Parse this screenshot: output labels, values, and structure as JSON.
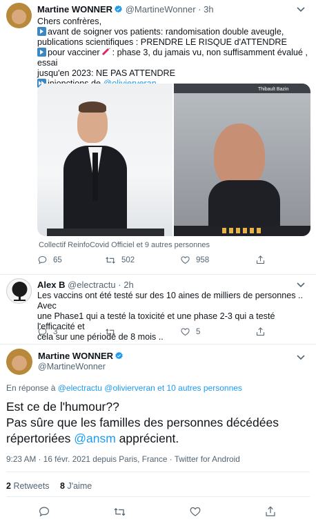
{
  "tweet1": {
    "author_name": "Martine WONNER",
    "author_handle": "@MartineWonner",
    "dot": "·",
    "time": "3h",
    "lines": [
      "Chers confrères,",
      "avant de soigner vos patients: randomisation double aveugle,",
      "publications scientifiques : PRENDRE LE RISQUE d'ATTENDRE",
      "pour vacciner",
      ": phase 3,  du jamais vu, non suffisamment évalué , essai",
      "jusqu'en 2023: NE PAS ATTENDRE",
      "injonctions de",
      "@olivierveran"
    ],
    "video_overlay_name": "Thibault Bazin",
    "liked_by": "Collectif ReinfoCovid Officiel et 9 autres personnes",
    "replies": "65",
    "retweets": "502",
    "likes": "958"
  },
  "reply": {
    "author_name": "Alex B",
    "author_handle": "@electractu",
    "dot": "·",
    "time": "2h",
    "lines": [
      "Les vaccins ont été testé sur des 10 aines de milliers de personnes .. Avec",
      "une Phase1 qui a testé la toxicité et une phase 2-3 qui a testé l'efficacité et",
      "cela sur une période de 8 mois .."
    ],
    "replies": "3",
    "retweets": "",
    "likes": "5"
  },
  "main": {
    "author_name": "Martine WONNER",
    "author_handle": "@MartineWonner",
    "in_reply_prefix": "En réponse à",
    "in_reply_users": "@electractu @olivierveran",
    "in_reply_suffix": " et 10 autres personnes",
    "text_line1": "Est ce de l'humour??",
    "text_line2": "Pas sûre que les familles des personnes décédées",
    "text_line3_pre": "répertoriées ",
    "text_line3_mention": "@ansm",
    "text_line3_post": " apprécient.",
    "meta": "9:23 AM · 16 févr. 2021 depuis Paris, France · Twitter for Android",
    "retweets_count": "2",
    "retweets_label": "Retweets",
    "likes_count": "8",
    "likes_label": "J'aime"
  },
  "icons": {
    "verified": "verified-badge-icon",
    "more": "chevron-down-icon",
    "reply": "reply-icon",
    "retweet": "retweet-icon",
    "like": "heart-icon",
    "share": "share-icon"
  },
  "colors": {
    "accent": "#1d9bf0",
    "text": "#0f1419",
    "muted": "#536471",
    "separator": "#e6ecf0"
  }
}
